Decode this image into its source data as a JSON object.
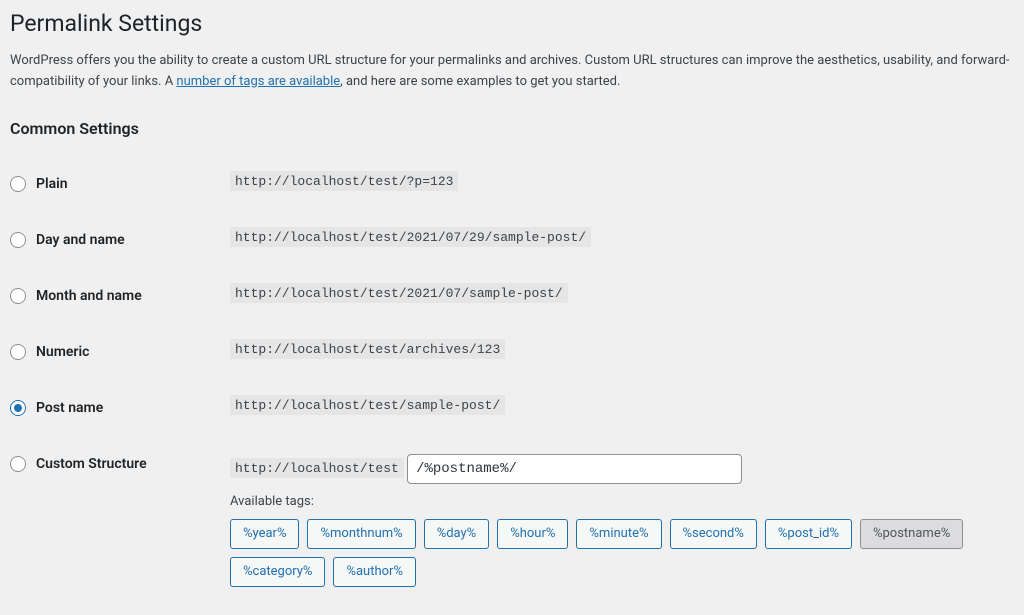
{
  "page_title": "Permalink Settings",
  "description_pre": "WordPress offers you the ability to create a custom URL structure for your permalinks and archives. Custom URL structures can improve the aesthetics, usability, and forward-compatibility of your links. A ",
  "description_link": "number of tags are available",
  "description_post": ", and here are some examples to get you started.",
  "common_settings_heading": "Common Settings",
  "options": {
    "plain": {
      "label": "Plain",
      "example": "http://localhost/test/?p=123"
    },
    "day_name": {
      "label": "Day and name",
      "example": "http://localhost/test/2021/07/29/sample-post/"
    },
    "month_name": {
      "label": "Month and name",
      "example": "http://localhost/test/2021/07/sample-post/"
    },
    "numeric": {
      "label": "Numeric",
      "example": "http://localhost/test/archives/123"
    },
    "post_name": {
      "label": "Post name",
      "example": "http://localhost/test/sample-post/"
    },
    "custom": {
      "label": "Custom Structure",
      "base": "http://localhost/test",
      "value": "/%postname%/"
    }
  },
  "available_tags_label": "Available tags:",
  "tags": {
    "year": "%year%",
    "monthnum": "%monthnum%",
    "day": "%day%",
    "hour": "%hour%",
    "minute": "%minute%",
    "second": "%second%",
    "post_id": "%post_id%",
    "postname": "%postname%",
    "category": "%category%",
    "author": "%author%"
  }
}
